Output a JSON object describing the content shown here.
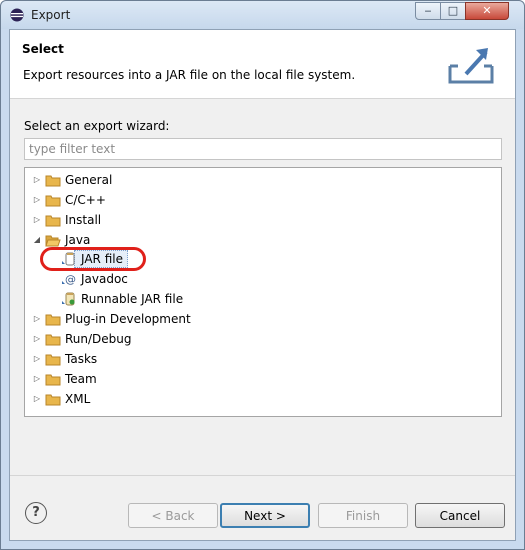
{
  "window": {
    "title": "Export",
    "controls": {
      "minimize": "‒",
      "maximize": "□",
      "close": "✕"
    }
  },
  "banner": {
    "title": "Select",
    "description": "Export resources into a JAR file on the local file system."
  },
  "wizard_label": "Select an export wizard:",
  "filter": {
    "placeholder": "type filter text",
    "value": ""
  },
  "tree": {
    "items": [
      {
        "label": "General",
        "expanded": false,
        "icon": "folder-icon"
      },
      {
        "label": "C/C++",
        "expanded": false,
        "icon": "folder-icon"
      },
      {
        "label": "Install",
        "expanded": false,
        "icon": "folder-icon"
      },
      {
        "label": "Java",
        "expanded": true,
        "icon": "folder-open-icon",
        "children": [
          {
            "label": "JAR file",
            "icon": "jar-icon",
            "selected": true
          },
          {
            "label": "Javadoc",
            "icon": "javadoc-icon"
          },
          {
            "label": "Runnable JAR file",
            "icon": "runnable-jar-icon"
          }
        ]
      },
      {
        "label": "Plug-in Development",
        "expanded": false,
        "icon": "folder-icon"
      },
      {
        "label": "Run/Debug",
        "expanded": false,
        "icon": "folder-icon"
      },
      {
        "label": "Tasks",
        "expanded": false,
        "icon": "folder-icon"
      },
      {
        "label": "Team",
        "expanded": false,
        "icon": "folder-icon"
      },
      {
        "label": "XML",
        "expanded": false,
        "icon": "folder-icon"
      }
    ]
  },
  "buttons": {
    "help": "?",
    "back": "< Back",
    "next": "Next >",
    "finish": "Finish",
    "cancel": "Cancel"
  },
  "colors": {
    "highlight_oval": "#e0201a",
    "selection": "#e5eef9",
    "folder": "#e8b64c"
  }
}
